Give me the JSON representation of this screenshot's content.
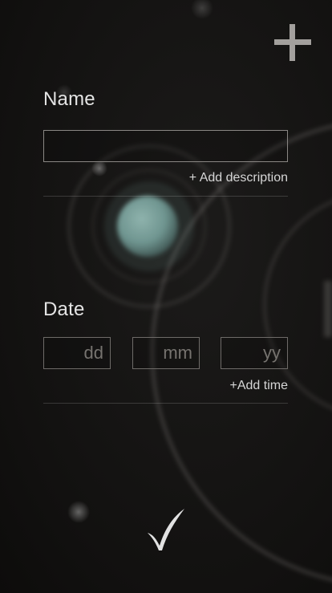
{
  "icons": {
    "add": "plus-icon",
    "confirm": "checkmark-icon"
  },
  "colors": {
    "text": "#e4e4e4",
    "field_border": "#8a8784",
    "planet": "#6f9590",
    "background": "#141312"
  },
  "name_section": {
    "title": "Name",
    "input_value": "",
    "input_placeholder": "",
    "add_description_label": "+ Add description"
  },
  "date_section": {
    "title": "Date",
    "day_placeholder": "dd",
    "month_placeholder": "mm",
    "year_placeholder": "yy",
    "add_time_label": "+Add time"
  }
}
